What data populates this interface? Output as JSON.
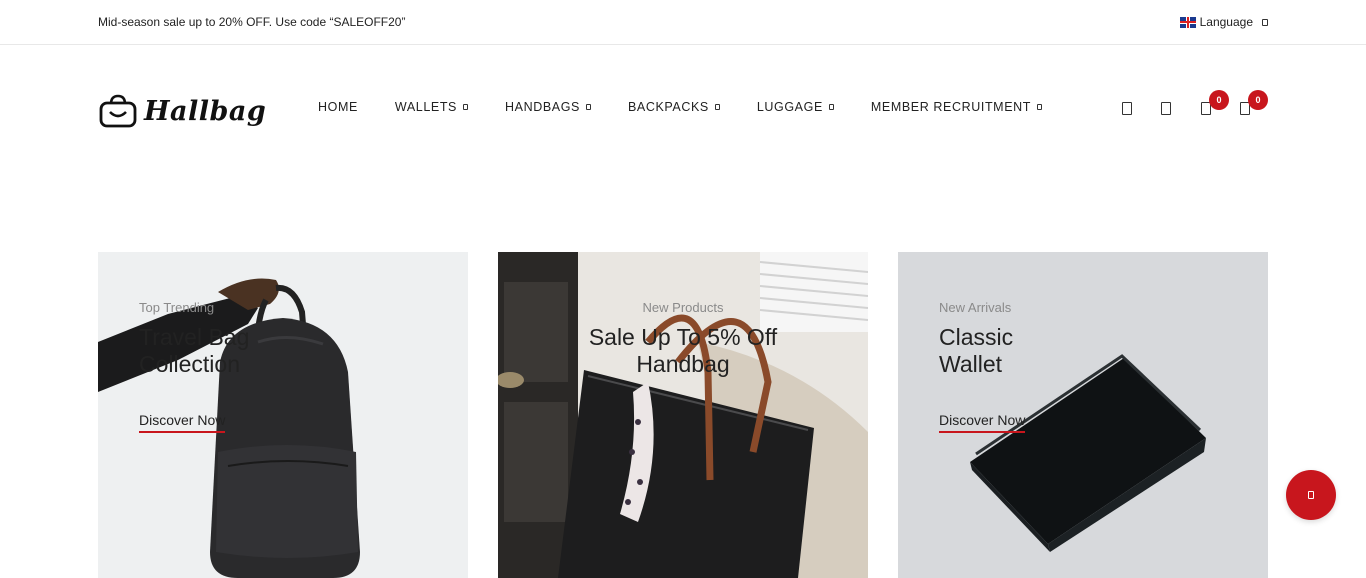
{
  "topbar": {
    "promo": "Mid-season sale up to 20% OFF. Use code “SALEOFF20”",
    "language_label": "Language"
  },
  "brand": {
    "name": "Hallbag"
  },
  "nav": {
    "items": [
      {
        "label": "HOME",
        "has_dropdown": false
      },
      {
        "label": "WALLETS",
        "has_dropdown": true
      },
      {
        "label": "HANDBAGS",
        "has_dropdown": true
      },
      {
        "label": "BACKPACKS",
        "has_dropdown": true
      },
      {
        "label": "LUGGAGE",
        "has_dropdown": true
      },
      {
        "label": "MEMBER RECRUITMENT",
        "has_dropdown": true
      }
    ]
  },
  "header_icons": {
    "search_icon": "search-icon",
    "account_icon": "user-icon",
    "wishlist_icon": "heart-icon",
    "wishlist_count": "0",
    "cart_icon": "cart-icon",
    "cart_count": "0"
  },
  "banners": [
    {
      "subtitle": "Top Trending",
      "title_line1": "Travel Bag",
      "title_line2": "Collection",
      "link": "Discover Now"
    },
    {
      "subtitle": "New Products",
      "title_line1": "Sale Up To 5% Off",
      "title_line2": "Handbag",
      "link": ""
    },
    {
      "subtitle": "New Arrivals",
      "title_line1": "Classic",
      "title_line2": "Wallet",
      "link": "Discover Now"
    }
  ],
  "fab": {
    "icon": "chat-icon"
  },
  "colors": {
    "accent": "#c8161d",
    "text": "#222222"
  }
}
